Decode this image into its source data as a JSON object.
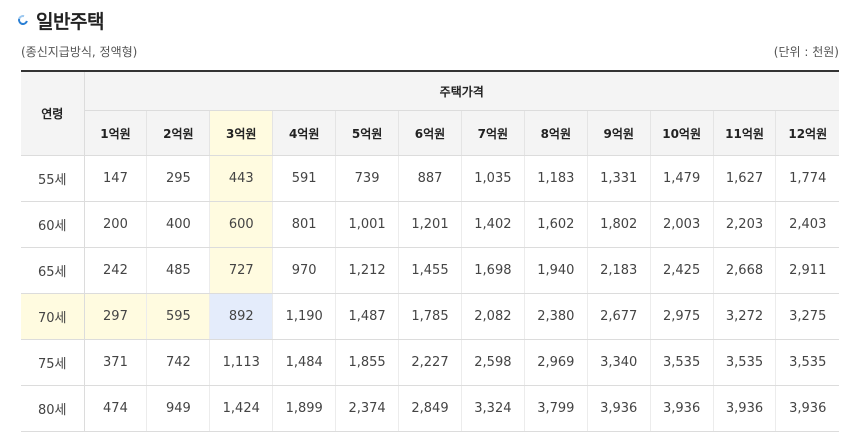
{
  "header": {
    "title": "일반주택",
    "subtitle": "(종신지급방식, 정액형)",
    "unit": "(단위 : 천원)"
  },
  "table": {
    "age_header": "연령",
    "price_header": "주택가격",
    "columns": [
      "1억원",
      "2억원",
      "3억원",
      "4억원",
      "5억원",
      "6억원",
      "7억원",
      "8억원",
      "9억원",
      "10억원",
      "11억원",
      "12억원"
    ],
    "rows": [
      {
        "age": "55세",
        "values": [
          "147",
          "295",
          "443",
          "591",
          "739",
          "887",
          "1,035",
          "1,183",
          "1,331",
          "1,479",
          "1,627",
          "1,774"
        ]
      },
      {
        "age": "60세",
        "values": [
          "200",
          "400",
          "600",
          "801",
          "1,001",
          "1,201",
          "1,402",
          "1,602",
          "1,802",
          "2,003",
          "2,203",
          "2,403"
        ]
      },
      {
        "age": "65세",
        "values": [
          "242",
          "485",
          "727",
          "970",
          "1,212",
          "1,455",
          "1,698",
          "1,940",
          "2,183",
          "2,425",
          "2,668",
          "2,911"
        ]
      },
      {
        "age": "70세",
        "values": [
          "297",
          "595",
          "892",
          "1,190",
          "1,487",
          "1,785",
          "2,082",
          "2,380",
          "2,677",
          "2,975",
          "3,272",
          "3,275"
        ]
      },
      {
        "age": "75세",
        "values": [
          "371",
          "742",
          "1,113",
          "1,484",
          "1,855",
          "2,227",
          "2,598",
          "2,969",
          "3,340",
          "3,535",
          "3,535",
          "3,535"
        ]
      },
      {
        "age": "80세",
        "values": [
          "474",
          "949",
          "1,424",
          "1,899",
          "2,374",
          "2,849",
          "3,324",
          "3,799",
          "3,936",
          "3,936",
          "3,936",
          "3,936"
        ]
      }
    ],
    "highlight": {
      "column_index": 2,
      "row_index": 3
    },
    "colors": {
      "highlight": "#fffbe0",
      "intersection": "#e4ecfb",
      "header_bg": "#f4f4f4"
    }
  }
}
